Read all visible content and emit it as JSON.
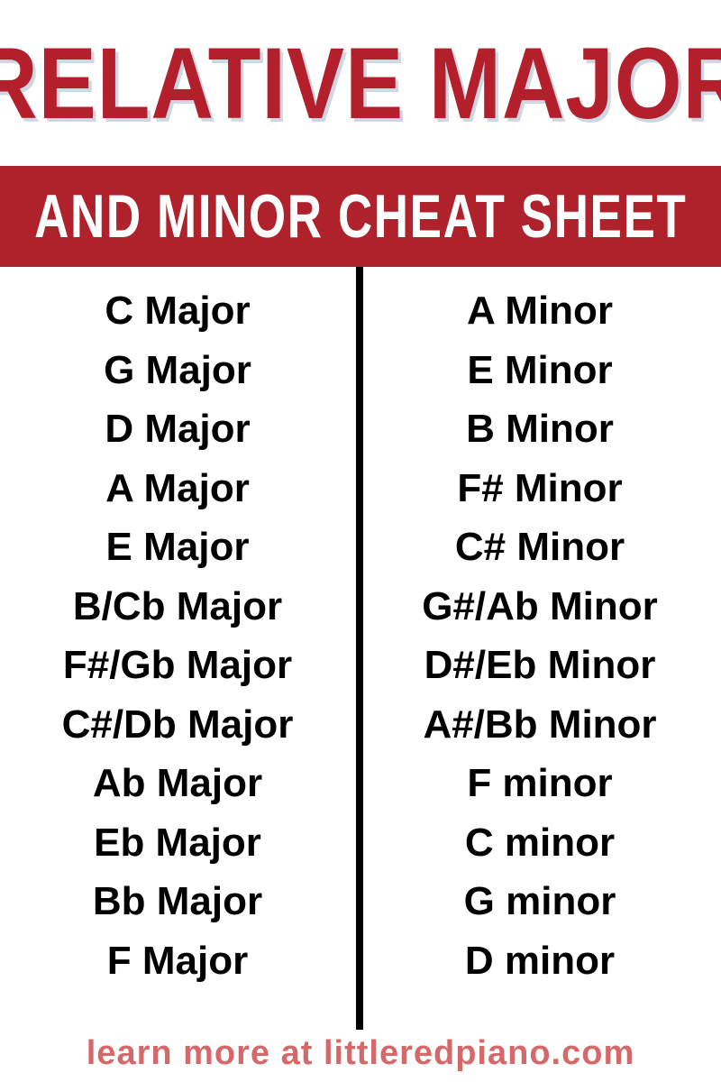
{
  "title": {
    "line1": "RELATIVE MAJOR",
    "line2": "AND MINOR CHEAT SHEET"
  },
  "major_keys": [
    "C Major",
    "G Major",
    "D Major",
    "A Major",
    "E Major",
    "B/Cb Major",
    "F#/Gb Major",
    "C#/Db Major",
    "Ab Major",
    "Eb Major",
    "Bb Major",
    "F Major"
  ],
  "minor_keys": [
    "A Minor",
    "E Minor",
    "B Minor",
    "F# Minor",
    "C# Minor",
    "G#/Ab Minor",
    "D#/Eb Minor",
    "A#/Bb Minor",
    "F minor",
    "C minor",
    "G minor",
    "D minor"
  ],
  "footer": {
    "text": "learn more at littleredpiano.com"
  },
  "colors": {
    "accent_red": "#b0222b",
    "title_red": "#b31f2a",
    "footer_red": "#d5696a",
    "divider": "#000000",
    "text": "#000000",
    "background": "#ffffff"
  }
}
